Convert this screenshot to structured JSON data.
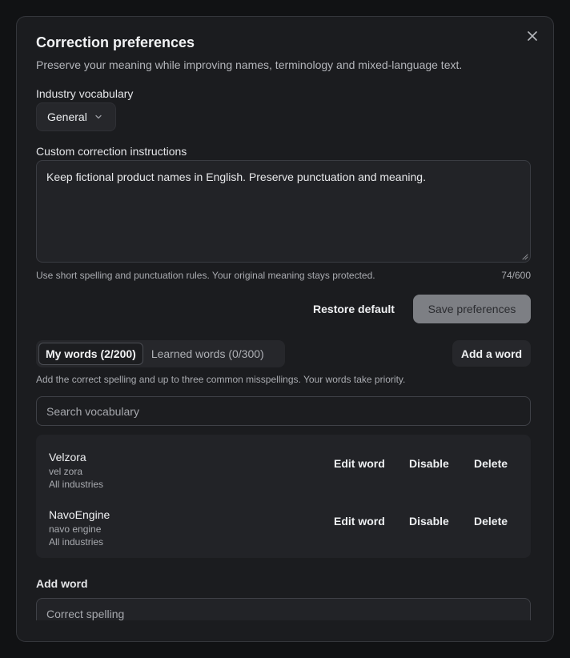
{
  "dialog": {
    "title": "Correction preferences",
    "subtitle": "Preserve your meaning while improving names, terminology and mixed-language text.",
    "close_icon": "close-icon"
  },
  "vocabulary": {
    "label": "Industry vocabulary",
    "selected": "General"
  },
  "instructions": {
    "label": "Custom correction instructions",
    "value": "Keep fictional product names in English. Preserve punctuation and meaning.",
    "hint": "Use short spelling and punctuation rules. Your original meaning stays protected.",
    "counter": "74/600"
  },
  "actions": {
    "restore_label": "Restore default",
    "save_label": "Save preferences"
  },
  "tabs": {
    "my_words": "My words (2/200)",
    "learned_words": "Learned words (0/300)",
    "add_word_button": "Add a word"
  },
  "words_helper": "Add the correct spelling and up to three common misspellings. Your words take priority.",
  "search": {
    "placeholder": "Search vocabulary"
  },
  "words": [
    {
      "word": "Velzora",
      "misspelling": "vel zora",
      "industry": "All industries",
      "edit": "Edit word",
      "disable": "Disable",
      "delete": "Delete"
    },
    {
      "word": "NavoEngine",
      "misspelling": "navo engine",
      "industry": "All industries",
      "edit": "Edit word",
      "disable": "Disable",
      "delete": "Delete"
    }
  ],
  "add_word": {
    "label": "Add word",
    "placeholder": "Correct spelling"
  },
  "colors": {
    "background": "#111214",
    "dialog": "#1b1c1f",
    "save_button": "#7d7f84"
  }
}
